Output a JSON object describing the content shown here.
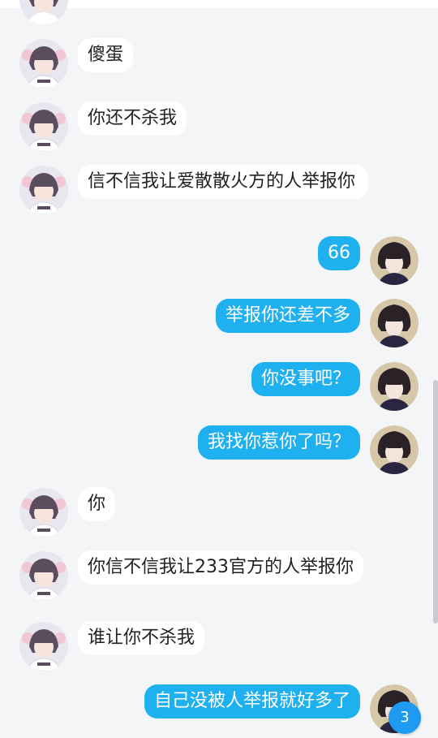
{
  "colors": {
    "background": "#f4f5f7",
    "incoming_bubble": "#ffffff",
    "outgoing_bubble": "#1fb0f0",
    "badge": "#1e9bf0"
  },
  "messages": [
    {
      "side": "left",
      "text": "傻蛋"
    },
    {
      "side": "left",
      "text": "你还不杀我"
    },
    {
      "side": "left",
      "text": "信不信我让爱散散火方的人举报你"
    },
    {
      "side": "right",
      "text": "66"
    },
    {
      "side": "right",
      "text": "举报你还差不多"
    },
    {
      "side": "right",
      "text": "你没事吧？"
    },
    {
      "side": "right",
      "text": "我找你惹你了吗？"
    },
    {
      "side": "left",
      "text": "你"
    },
    {
      "side": "left",
      "text": "你信不信我让233官方的人举报你"
    },
    {
      "side": "left",
      "text": "谁让你不杀我"
    },
    {
      "side": "right",
      "text": "自己没被人举报就好多了"
    }
  ],
  "unread_badge": "3"
}
